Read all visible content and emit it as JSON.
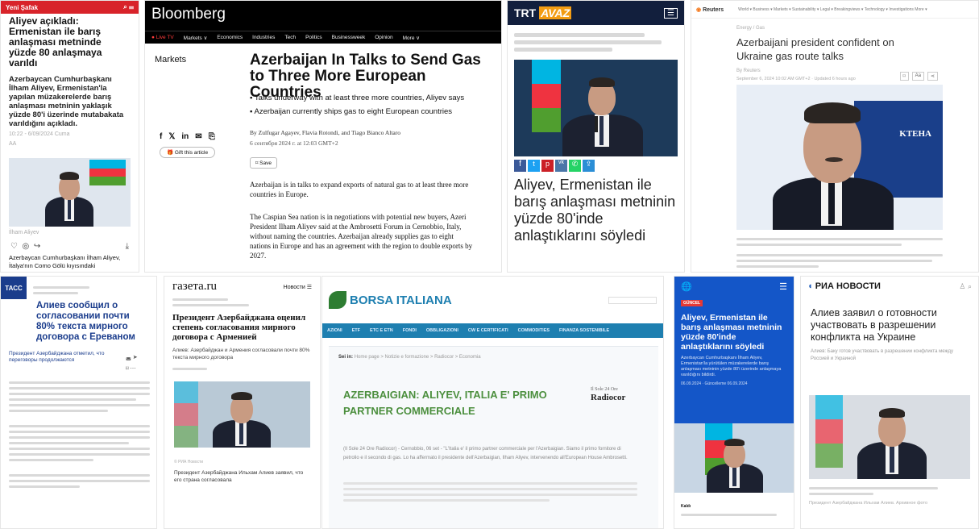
{
  "yeni_safak": {
    "brand": "Yeni Şafak",
    "headline": "Aliyev açıkladı: Ermenistan ile barış anlaşması metninde yüzde 80 anlaşmaya varıldı",
    "lead": "Azerbaycan Cumhurbaşkanı İlham Aliyev, Ermenistan'la yapılan müzakerelerde barış anlaşması metninin yaklaşık yüzde 80'i üzerinde mutabakata varıldığını açıkladı.",
    "meta": "10:22 - 6/09/2024 Cuma",
    "tag": "AA",
    "caption": "İlham Aliyev",
    "footer_text": "Azerbaycan Cumhurbaşkanı İlham Aliyev, İtalya'nın Como Gölü kıyısındaki"
  },
  "bloomberg": {
    "brand": "Bloomberg",
    "nav": [
      "● Live TV",
      "Markets ∨",
      "Economics",
      "Industries",
      "Tech",
      "Politics",
      "Businessweek",
      "Opinion",
      "More ∨"
    ],
    "section": "Markets",
    "headline": "Azerbaijan In Talks to Send Gas to Three More European Countries",
    "bullets": [
      "Talks underway with at least three more countries, Aliyev says",
      "Azerbaijan currently ships gas to eight European countries"
    ],
    "byline": "By Zulfugar Agayev, Flavia Rotondi, and Tiago Bianco Altaro",
    "date": "6 сентября 2024 г. at 12:03 GMT+2",
    "save": "Save",
    "gift": "Gift this article",
    "para1": "Azerbaijan is in talks to expand exports of natural gas to at least three more countries in Europe.",
    "para2": "The Caspian Sea nation is in negotiations with potential new buyers, Azeri President Ilham Aliyev said at the Ambrosetti Forum in Cernobbio, Italy, without naming the countries. Azerbaijan already supplies gas to eight nations in Europe and has an agreement with the region to double exports by 2027."
  },
  "trt": {
    "brand_a": "TRT",
    "brand_b": "AVAZ",
    "headline": "Aliyev, Ermenistan ile barış anlaşması metninin yüzde 80'inde anlaştıklarını söyledi"
  },
  "reuters": {
    "brand": "Reuters",
    "nav": "World ▾  Business ▾  Markets ▾  Sustainability ▾  Legal ▾  Breakingviews ▾  Technology ▾  Investigations  More ▾",
    "tag": "Energy / Gas",
    "headline": "Azerbaijani president confident on Ukraine gas route talks",
    "byline": "By Reuters",
    "date": "September 6, 2024 10:02 AM GMT+2 · Updated 6 hours ago",
    "aa": "Aa"
  },
  "tass": {
    "brand": "ТАСС",
    "headline": "Алиев сообщил о согласовании почти 80% текста мирного договора с Ереваном",
    "sub": "Президент Азербайджана отметил, что переговоры продолжаются"
  },
  "gazeta": {
    "brand": "газета.ru",
    "nav": "Новости",
    "headline": "Президент Азербайджана оценил степень согласования мирного договора с Арменией",
    "lead": "Алиев: Азербайджан и Армения согласовали почти 80% текста мирного договора",
    "photo_credit": "© РИА Новости",
    "footer": "Президент Азербайджана Ильхам Алиев заявил, что его страна согласовала"
  },
  "borsa": {
    "brand": "BORSA ITALIANA",
    "nav": [
      "AZIONI",
      "ETF",
      "ETC E ETN",
      "FONDI",
      "OBBLIGAZIONI",
      "CW E CERTIFICATI",
      "COMMODITIES",
      "FINANZA SOSTENIBILE"
    ],
    "breadcrumb_label": "Sei in:",
    "breadcrumb": "Home page > Notizie e formazione > Radiocor > Economia",
    "headline": "AZERBAIGIAN: ALIYEV, ITALIA E' PRIMO PARTNER COMMERCIALE",
    "logo_top": "Il Sole 24 Ore",
    "logo_bottom": "Radiocor",
    "body": "(Il Sole 24 Ore Radiocor) - Cernobbio, 06 set - \"L'Italia e' il primo partner commerciale per l'Azerbaigian. Siamo il primo fornitore di petrolio e il secondo di gas. Lo ha affermato il presidente dell'Azerbaigian, Ilham Aliyev, intervenendo all'European House Ambrosetti."
  },
  "aa": {
    "badge": "GÜNCEL",
    "headline": "Aliyev, Ermenistan ile barış anlaşması metninin yüzde 80'inde anlaştıklarını söyledi",
    "lead": "Azerbaycan Cumhurbaşkanı İlham Aliyev, Ermenistan'la yürütülen müzakerelerde barış anlaşması metninin yüzde 80'i üzerinde anlaşmaya varıldığını bildirdi.",
    "meta": "06.09.2024 · Güncelleme 06.09.2024",
    "footer_label": "Kaldı"
  },
  "ria": {
    "brand": "РИА НОВОСТИ",
    "headline": "Алиев заявил о готовности участвовать в разрешении конфликта на Украине",
    "lead": "Алиев: Баку готов участвовать в разрешении конфликта между Россией и Украиной",
    "footer": "Президент Азербайджана Ильхам Алиев. Архивное фото"
  },
  "colors": {
    "yeni": "#d8232a",
    "bloomberg_bar": "#000000",
    "trt": "#121f3d",
    "trt_avaz": "#f39c12",
    "tass": "#1a3c8c",
    "borsa": "#1e7fb0",
    "borsa_green": "#2e7d32",
    "aa": "#1456c8",
    "ria": "#1d5bb8"
  }
}
